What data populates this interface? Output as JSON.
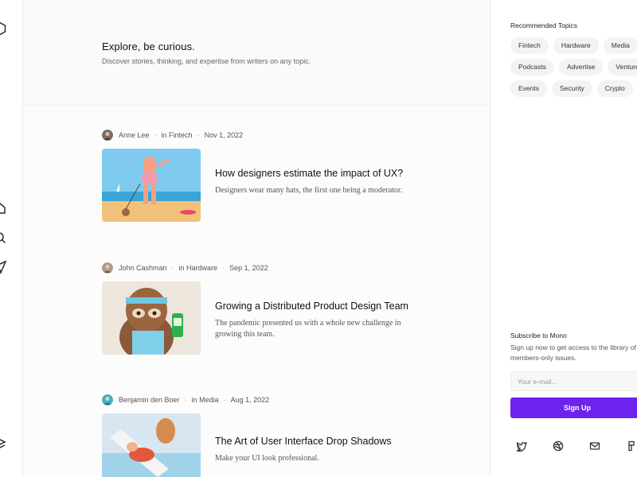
{
  "hero": {
    "title": "Explore, be curious.",
    "subtitle": "Discover stories, thinking, and expertise from writers on any topic."
  },
  "rail": {
    "icons": [
      "logo-hexagon-icon",
      "home-icon",
      "search-icon",
      "send-icon",
      "stack-icon"
    ]
  },
  "articles": [
    {
      "author": "Anne Lee",
      "category": "in Fintech",
      "date": "Nov 1, 2022",
      "title": "How designers estimate the impact of UX?",
      "description": "Designers wear many hats, the first one being a moderator."
    },
    {
      "author": "John Cashman",
      "category": "in Hardware",
      "date": "Sep 1, 2022",
      "title": "Growing a Distributed Product Design Team",
      "description": "The pandemic presented us with a whole new challenge in growing this team."
    },
    {
      "author": "Benjamin den Boer",
      "category": "in Media",
      "date": "Aug 1, 2022",
      "title": "The Art of User Interface Drop Shadows",
      "description": "Make your UI look professional."
    }
  ],
  "sidebar": {
    "topics_heading": "Recommended Topics",
    "topic_rows": [
      [
        "Fintech",
        "Hardware",
        "Media"
      ],
      [
        "Podcasts",
        "Advertise",
        "Venture"
      ],
      [
        "Events",
        "Security",
        "Crypto"
      ]
    ],
    "subscribe_heading": "Subscribe to Mono",
    "subscribe_text_1": "Sign up now to get access to the library of",
    "subscribe_text_2": "members-only issues.",
    "email_placeholder": "Your e-mail...",
    "signup_label": "Sign Up",
    "social_icons": [
      "twitter-icon",
      "dribbble-icon",
      "mail-icon",
      "figma-icon"
    ]
  },
  "colors": {
    "accent": "#6e22ee",
    "border": "#ececec"
  }
}
